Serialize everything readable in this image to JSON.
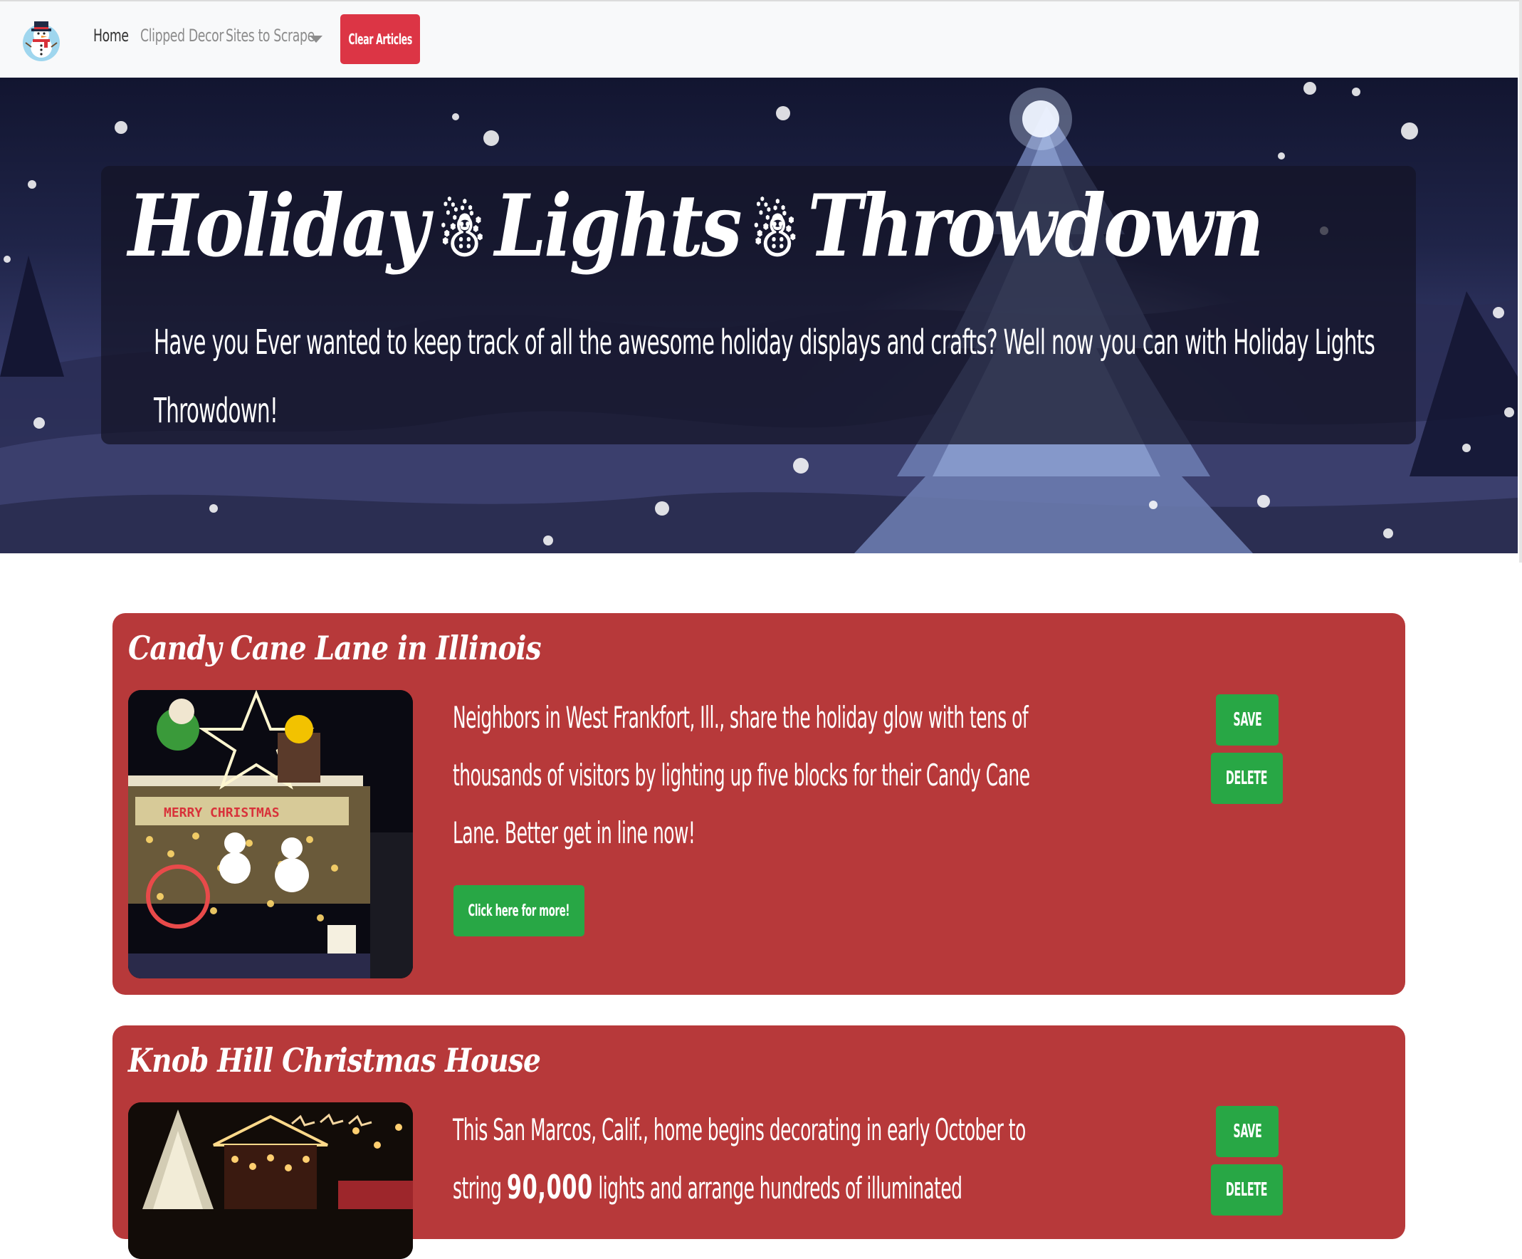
{
  "navbar": {
    "home": "Home",
    "clipped_decor": "Clipped Decor",
    "sites_to_scrape": "Sites to Scrape",
    "clear_articles": "Clear Articles"
  },
  "hero": {
    "title_part1": "Holiday",
    "title_part2": "Lights",
    "title_part3": "Throwdown",
    "title_icon": "☃",
    "lead_line1": "Have you Ever wanted to keep track of all the awesome holiday displays and crafts? Well now you can with Holiday Lights",
    "lead_line2": "Throwdown!"
  },
  "articles": [
    {
      "title": "Candy Cane Lane in Illinois",
      "text_lines": [
        "Neighbors in West Frankfort, Ill., share the holiday glow with tens of",
        "thousands of visitors by lighting up five blocks for their Candy Cane",
        "Lane. Better get in line now!"
      ],
      "more_label": "Click here for more!",
      "save_label": "SAVE",
      "delete_label": "DELETE",
      "image_caption": "MERRY CHRISTMAS"
    },
    {
      "title": "Knob Hill Christmas House",
      "text_line1": "This San Marcos, Calif., home begins decorating in early October to",
      "text_line2_prefix": "string ",
      "text_line2_number": "90,000",
      "text_line2_suffix": " lights and arrange hundreds of illuminated",
      "save_label": "SAVE",
      "delete_label": "DELETE"
    }
  ],
  "colors": {
    "card_bg": "#b7393a",
    "button_green": "#28a745",
    "clear_red": "#dc3545",
    "navbar_bg": "#f8f9fa"
  },
  "icons": {
    "brand": "snowman-logo-icon",
    "dropdown": "caret-down-icon",
    "title_ornament": "snowman-icon"
  }
}
